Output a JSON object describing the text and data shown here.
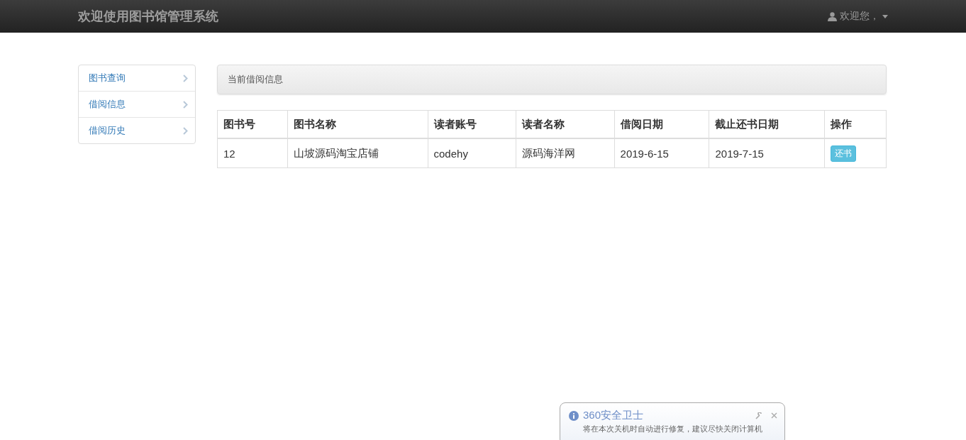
{
  "navbar": {
    "brand": "欢迎使用图书馆管理系统",
    "user_menu": "欢迎您，"
  },
  "sidebar": {
    "items": [
      {
        "label": "图书查询"
      },
      {
        "label": "借阅信息"
      },
      {
        "label": "借阅历史"
      }
    ]
  },
  "panel": {
    "title": "当前借阅信息"
  },
  "table": {
    "columns": [
      "图书号",
      "图书名称",
      "读者账号",
      "读者名称",
      "借阅日期",
      "截止还书日期",
      "操作"
    ],
    "rows": [
      {
        "cells": [
          "12",
          "山坡源码淘宝店铺",
          "codehy",
          "源码海洋网",
          "2019-6-15",
          "2019-7-15"
        ],
        "action": "还书"
      }
    ]
  },
  "notification": {
    "title": "360安全卫士",
    "message": "将在本次关机时自动进行修复，建议尽快关闭计算机"
  }
}
